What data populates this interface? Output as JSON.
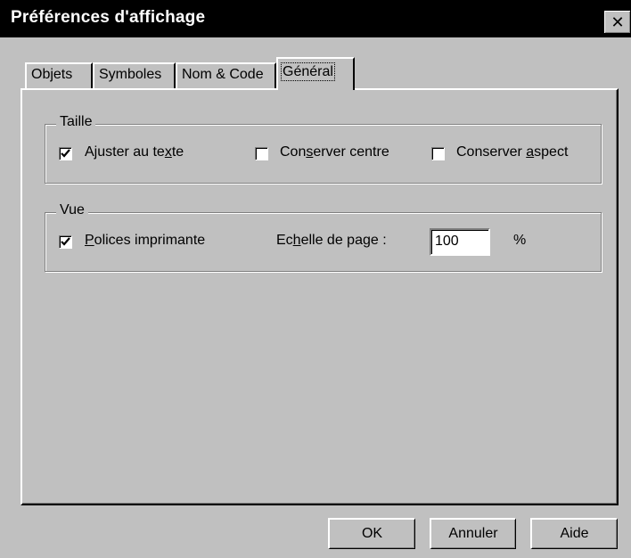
{
  "window": {
    "title": "Préférences d'affichage",
    "close_symbol": "✕"
  },
  "tabs": [
    {
      "label": "Objets",
      "active": false
    },
    {
      "label": "Symboles",
      "active": false
    },
    {
      "label": "Nom & Code",
      "active": false
    },
    {
      "label": "Général",
      "active": true
    }
  ],
  "taille": {
    "label": "Taille",
    "ajuster": {
      "pre": "Ajuster au te",
      "u": "x",
      "post": "te",
      "checked": true
    },
    "centre": {
      "pre": "Con",
      "u": "s",
      "post": "erver centre",
      "checked": false
    },
    "aspect": {
      "pre": "Conserver ",
      "u": "a",
      "post": "spect",
      "checked": false
    }
  },
  "vue": {
    "label": "Vue",
    "polices": {
      "pre": "",
      "u": "P",
      "post": "olices imprimante",
      "checked": true
    },
    "echelle": {
      "pre": "Ec",
      "u": "h",
      "post": "elle de page :"
    },
    "echelle_value": "100",
    "unit": "%"
  },
  "buttons": {
    "ok": "OK",
    "cancel": "Annuler",
    "help": "Aide"
  }
}
